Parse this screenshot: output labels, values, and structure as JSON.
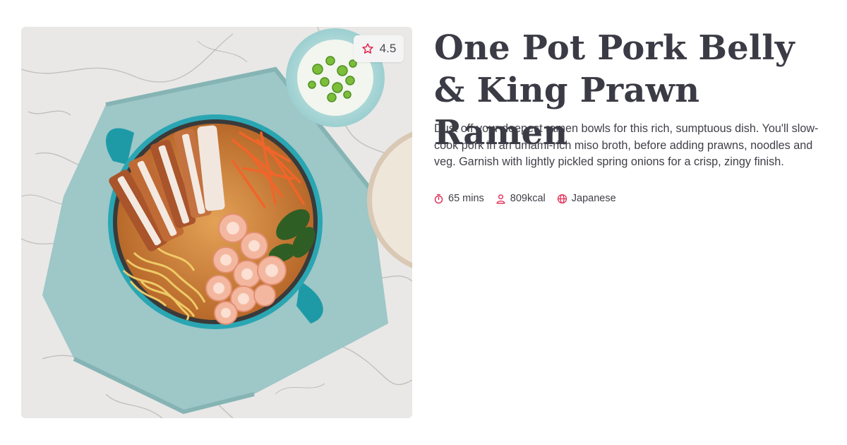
{
  "recipe": {
    "title": "One Pot Pork Belly & King Prawn Ramen",
    "description": "Dust off your deepest ramen bowls for this rich, sumptuous dish. You'll slow-cook pork in an umami-rich miso broth, before adding prawns, noodles and veg. Garnish with lightly pickled spring onions for a crisp, zingy finish.",
    "rating": "4.5",
    "meta": {
      "time": "65 mins",
      "calories": "809kcal",
      "cuisine": "Japanese"
    },
    "icons": {
      "rating": "star-icon",
      "time": "stopwatch-icon",
      "calories": "person-icon",
      "cuisine": "globe-icon"
    }
  },
  "theme": {
    "accent": "#e0284f",
    "text": "#3b3b45",
    "badge_bg": "#f4f4f4"
  }
}
